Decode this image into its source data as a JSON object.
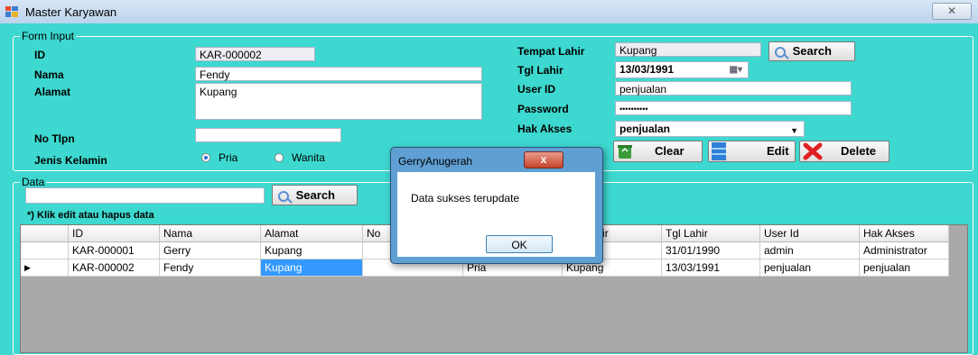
{
  "window": {
    "title": "Master Karyawan",
    "close_glyph": "✕"
  },
  "form_input": {
    "legend": "Form Input",
    "id_label": "ID",
    "id_value": "KAR-000002",
    "nama_label": "Nama",
    "nama_value": "Fendy",
    "alamat_label": "Alamat",
    "alamat_value": "Kupang",
    "no_tlpn_label": "No Tlpn",
    "no_tlpn_value": "",
    "jenis_kelamin_label": "Jenis Kelamin",
    "radio_pria": "Pria",
    "radio_wanita": "Wanita",
    "tempat_lahir_label": "Tempat Lahir",
    "tempat_lahir_value": "Kupang",
    "tgl_lahir_label": "Tgl Lahir",
    "tgl_lahir_value": "13/03/1991",
    "user_id_label": "User ID",
    "user_id_value": "penjualan",
    "password_label": "Password",
    "password_value": "••••••••••",
    "hak_akses_label": "Hak Akses",
    "hak_akses_value": "penjualan",
    "search_button": "Search",
    "clear_button": "Clear",
    "edit_button": "Edit",
    "delete_button": "Delete"
  },
  "data_group": {
    "legend": "Data",
    "search_value": "",
    "search_button": "Search",
    "hint": "*) Klik edit atau hapus data"
  },
  "grid": {
    "columns": [
      "ID",
      "Nama",
      "Alamat",
      "No",
      "",
      "pat Lahir",
      "Tgl Lahir",
      "User Id",
      "Hak Akses"
    ],
    "rows": [
      {
        "marker": "",
        "cells": [
          "KAR-000001",
          "Gerry",
          "Kupang",
          "",
          "",
          "ng",
          "31/01/1990",
          "admin",
          "Administrator"
        ]
      },
      {
        "marker": "▶",
        "cells": [
          "KAR-000002",
          "Fendy",
          "Kupang",
          "",
          "Pria",
          "Kupang",
          "13/03/1991",
          "penjualan",
          "penjualan"
        ]
      }
    ]
  },
  "dialog": {
    "title": "GerryAnugerah",
    "close_glyph": "x",
    "message": "Data sukses terupdate",
    "ok_button": "OK"
  }
}
